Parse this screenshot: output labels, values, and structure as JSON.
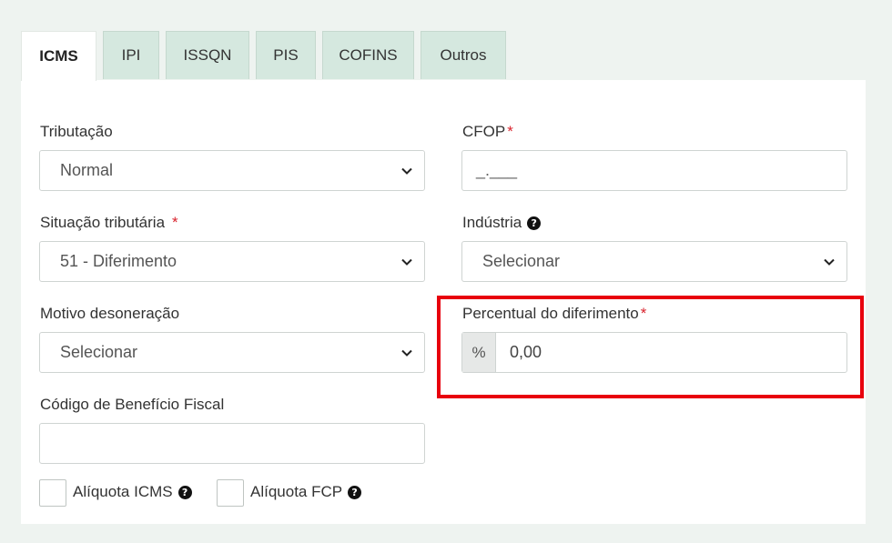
{
  "tabs": [
    {
      "label": "ICMS",
      "active": true
    },
    {
      "label": "IPI",
      "active": false
    },
    {
      "label": "ISSQN",
      "active": false
    },
    {
      "label": "PIS",
      "active": false
    },
    {
      "label": "COFINS",
      "active": false
    },
    {
      "label": "Outros",
      "active": false
    }
  ],
  "form": {
    "tributacao": {
      "label": "Tributação",
      "value": "Normal"
    },
    "cfop": {
      "label": "CFOP",
      "required": "*",
      "value": "_.___"
    },
    "situacao": {
      "label": "Situação tributária",
      "required": "*",
      "value": "51 - Diferimento"
    },
    "industria": {
      "label": "Indústria",
      "value": "Selecionar",
      "help": "?"
    },
    "motivo": {
      "label": "Motivo desoneração",
      "value": "Selecionar"
    },
    "percentual": {
      "label": "Percentual do diferimento",
      "required": "*",
      "addon": "%",
      "value": "0,00"
    },
    "beneficio": {
      "label": "Código de Benefício Fiscal",
      "value": ""
    },
    "aliquota_icms": {
      "label": "Alíquota ICMS",
      "help": "?"
    },
    "aliquota_fcp": {
      "label": "Alíquota FCP",
      "help": "?"
    }
  },
  "colors": {
    "highlight": "#e8000d",
    "tab_bg": "#d5e8df",
    "required": "#d9232d"
  }
}
